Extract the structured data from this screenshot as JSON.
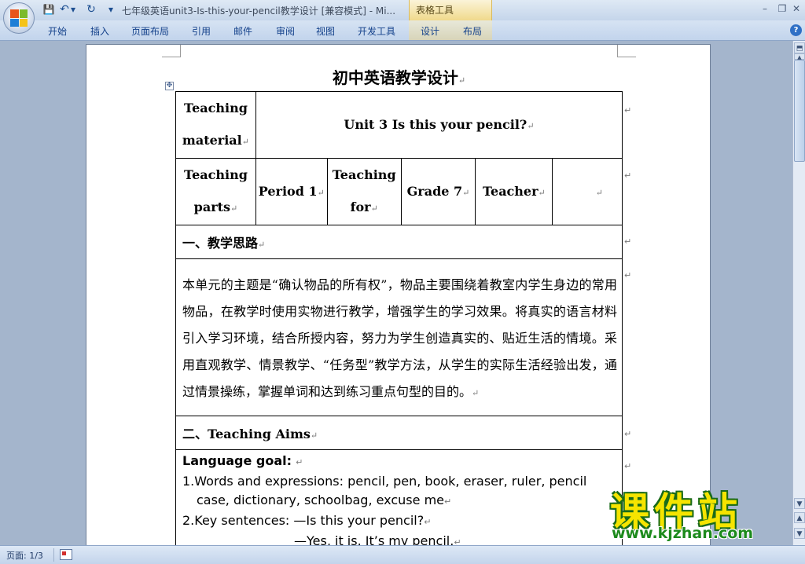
{
  "titlebar": {
    "doc_title": "七年级英语unit3-Is-this-your-pencil教学设计 [兼容模式] - Mi...",
    "contextual_tab": "表格工具",
    "minimize": "–",
    "restore": "❐",
    "close": "✕"
  },
  "quick_access": {
    "save": "💾",
    "undo": "↶",
    "undo_dropdown": "▾",
    "redo": "↻",
    "customize": "▾"
  },
  "ribbon": {
    "tabs": [
      "开始",
      "插入",
      "页面布局",
      "引用",
      "邮件",
      "审阅",
      "视图",
      "开发工具",
      "设计",
      "布局"
    ],
    "help": "?"
  },
  "document": {
    "heading": "初中英语教学设计",
    "para_mark": "↵",
    "table_move_handle": "✥",
    "rows": {
      "material_label": [
        "Teaching",
        "material"
      ],
      "material_value": "Unit 3 Is this your pencil?",
      "parts_label": [
        "Teaching",
        "parts"
      ],
      "period": "Period 1",
      "teaching_for": [
        "Teaching",
        "for"
      ],
      "grade": "Grade 7",
      "teacher_label": "Teacher",
      "teacher_value": "",
      "section1_title": "一、教学思路",
      "section1_text": "本单元的主题是“确认物品的所有权”，物品主要围绕着教室内学生身边的常用物品，在教学时使用实物进行教学，增强学生的学习效果。将真实的语言材料引入学习环境，结合所授内容，努力为学生创造真实的、贴近生活的情境。采用直观教学、情景教学、“任务型”教学方法，从学生的实际生活经验出发，通过情景操练，掌握单词和达到练习重点句型的目的。",
      "section2_title": "二、Teaching Aims",
      "language_goal": "Language goal:",
      "item1_line1": "1.Words and expressions: pencil, pen, book, eraser, ruler, pencil",
      "item1_line2": "case, dictionary, schoolbag, excuse me",
      "item2_line1": "2.Key sentences: —Is this your pencil?",
      "item2_line2": "—Yes, it is. It’s my pencil."
    }
  },
  "scrollbar": {
    "up": "▲",
    "down": "▼",
    "prev_page": "▲",
    "next_page": "▼",
    "split": "⬒"
  },
  "statusbar": {
    "page_count": "页面: 1/3"
  },
  "watermark": {
    "title": "课件站",
    "url": "www.kjzhan.com"
  }
}
